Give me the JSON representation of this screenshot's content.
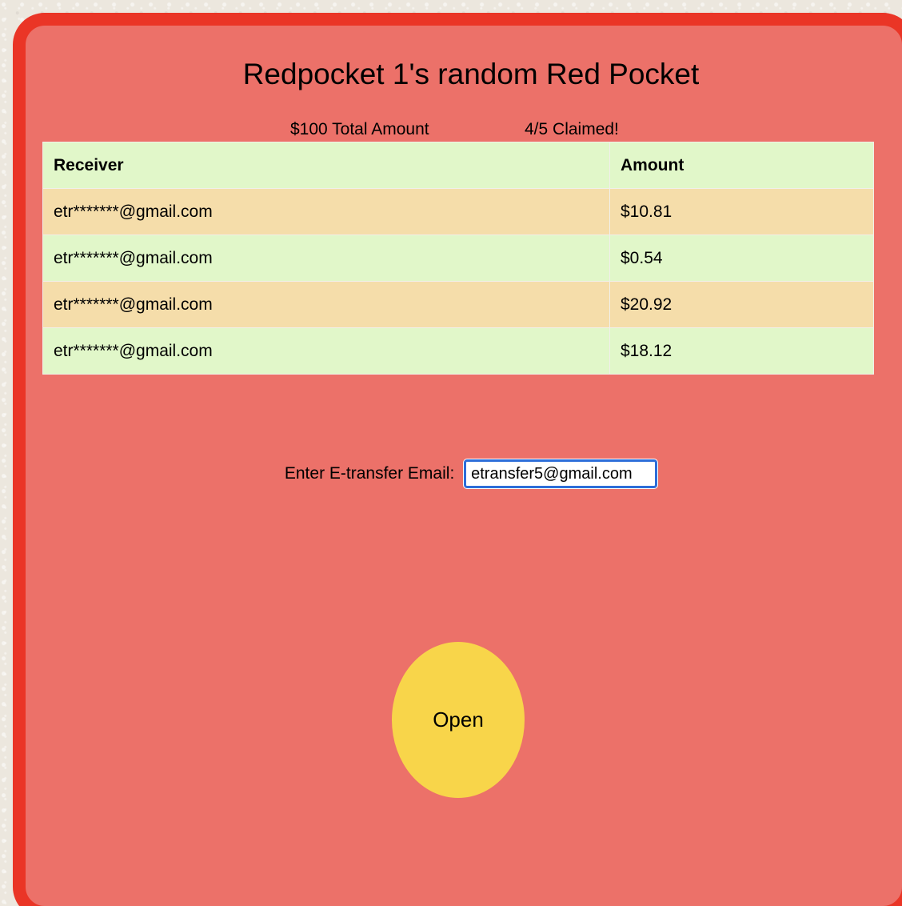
{
  "title": "Redpocket 1's random Red Pocket",
  "stats": {
    "total": "$100 Total Amount",
    "claimed": "4/5 Claimed!"
  },
  "table": {
    "headers": [
      "Receiver",
      "Amount"
    ],
    "rows": [
      {
        "receiver": "etr*******@gmail.com",
        "amount": "$10.81"
      },
      {
        "receiver": "etr*******@gmail.com",
        "amount": "$0.54"
      },
      {
        "receiver": "etr*******@gmail.com",
        "amount": "$20.92"
      },
      {
        "receiver": "etr*******@gmail.com",
        "amount": "$18.12"
      }
    ]
  },
  "email": {
    "label": "Enter E-transfer Email:",
    "value": "etransfer5@gmail.com"
  },
  "open_button": {
    "label": "Open"
  },
  "colors": {
    "pocket_fill": "#ec7169",
    "pocket_border": "#ea3526",
    "row_odd": "#f5ddaa",
    "row_even": "#e1f7c9",
    "open_button": "#f8d54a",
    "input_focus": "#2d6ed9"
  }
}
